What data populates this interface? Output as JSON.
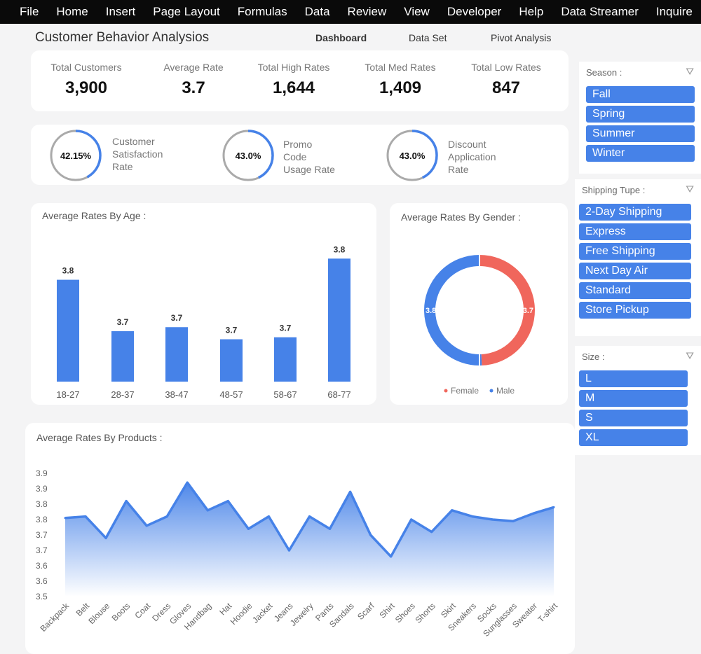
{
  "menu": [
    "File",
    "Home",
    "Insert",
    "Page Layout",
    "Formulas",
    "Data",
    "Review",
    "View",
    "Developer",
    "Help",
    "Data Streamer",
    "Inquire"
  ],
  "header": {
    "title": "Customer Behavior Analysios",
    "tabs": [
      "Dashboard",
      "Data Set",
      "Pivot Analysis"
    ]
  },
  "kpis": [
    {
      "label": "Total Customers",
      "value": "3,900"
    },
    {
      "label": "Average Rate",
      "value": "3.7"
    },
    {
      "label": "Total High Rates",
      "value": "1,644"
    },
    {
      "label": "Total Med Rates",
      "value": "1,409"
    },
    {
      "label": "Total Low Rates",
      "value": "847"
    }
  ],
  "gauges": [
    {
      "value": "42.15%",
      "fraction": 0.4215,
      "label": "Customer\nSatisfaction\nRate"
    },
    {
      "value": "43.0%",
      "fraction": 0.43,
      "label": "Promo\nCode\nUsage Rate"
    },
    {
      "value": "43.0%",
      "fraction": 0.43,
      "label": "Discount\nApplication\nRate"
    }
  ],
  "colors": {
    "accent": "#4682e8",
    "female": "#f0665c",
    "gauge_track": "#aaaaaa"
  },
  "slicers": {
    "season": {
      "title": "Season :",
      "items": [
        "Fall",
        "Spring",
        "Summer",
        "Winter"
      ]
    },
    "shipping": {
      "title": "Shipping Tupe :",
      "items": [
        "2-Day Shipping",
        "Express",
        "Free Shipping",
        "Next Day Air",
        "Standard",
        "Store Pickup"
      ]
    },
    "size": {
      "title": "Size :",
      "items": [
        "L",
        "M",
        "S",
        "XL"
      ]
    }
  },
  "chart_data": [
    {
      "type": "bar",
      "title": "Average Rates By Age :",
      "categories": [
        "18-27",
        "28-37",
        "38-47",
        "48-57",
        "58-67",
        "68-77"
      ],
      "values": [
        3.751,
        3.7,
        3.704,
        3.692,
        3.694,
        3.772
      ],
      "labels": [
        "3.8",
        "3.7",
        "3.7",
        "3.7",
        "3.7",
        "3.8"
      ],
      "ylim": [
        3.65,
        3.8
      ]
    },
    {
      "type": "pie",
      "title": "Average Rates By Gender :",
      "categories": [
        "Female",
        "Male"
      ],
      "values": [
        3.7,
        3.8
      ],
      "labels": [
        "3.7",
        "3.8"
      ],
      "legend": "bottom"
    },
    {
      "type": "area",
      "title": "Average Rates By Products :",
      "categories": [
        "Backpack",
        "Belt",
        "Blouse",
        "Boots",
        "Coat",
        "Dress",
        "Gloves",
        "Handbag",
        "Hat",
        "Hoodie",
        "Jacket",
        "Jeans",
        "Jewelry",
        "Pants",
        "Sandals",
        "Scarf",
        "Shirt",
        "Shoes",
        "Shorts",
        "Skirt",
        "Sneakers",
        "Socks",
        "Sunglasses",
        "Sweater",
        "T-shirt"
      ],
      "values": [
        3.755,
        3.76,
        3.69,
        3.81,
        3.73,
        3.76,
        3.87,
        3.78,
        3.81,
        3.72,
        3.76,
        3.65,
        3.76,
        3.72,
        3.84,
        3.7,
        3.63,
        3.75,
        3.71,
        3.78,
        3.76,
        3.75,
        3.745,
        3.77,
        3.79
      ],
      "yticks": [
        "3.9",
        "3.9",
        "3.8",
        "3.8",
        "3.7",
        "3.7",
        "3.6",
        "3.6",
        "3.5"
      ],
      "ylim": [
        3.5,
        3.9
      ]
    }
  ]
}
